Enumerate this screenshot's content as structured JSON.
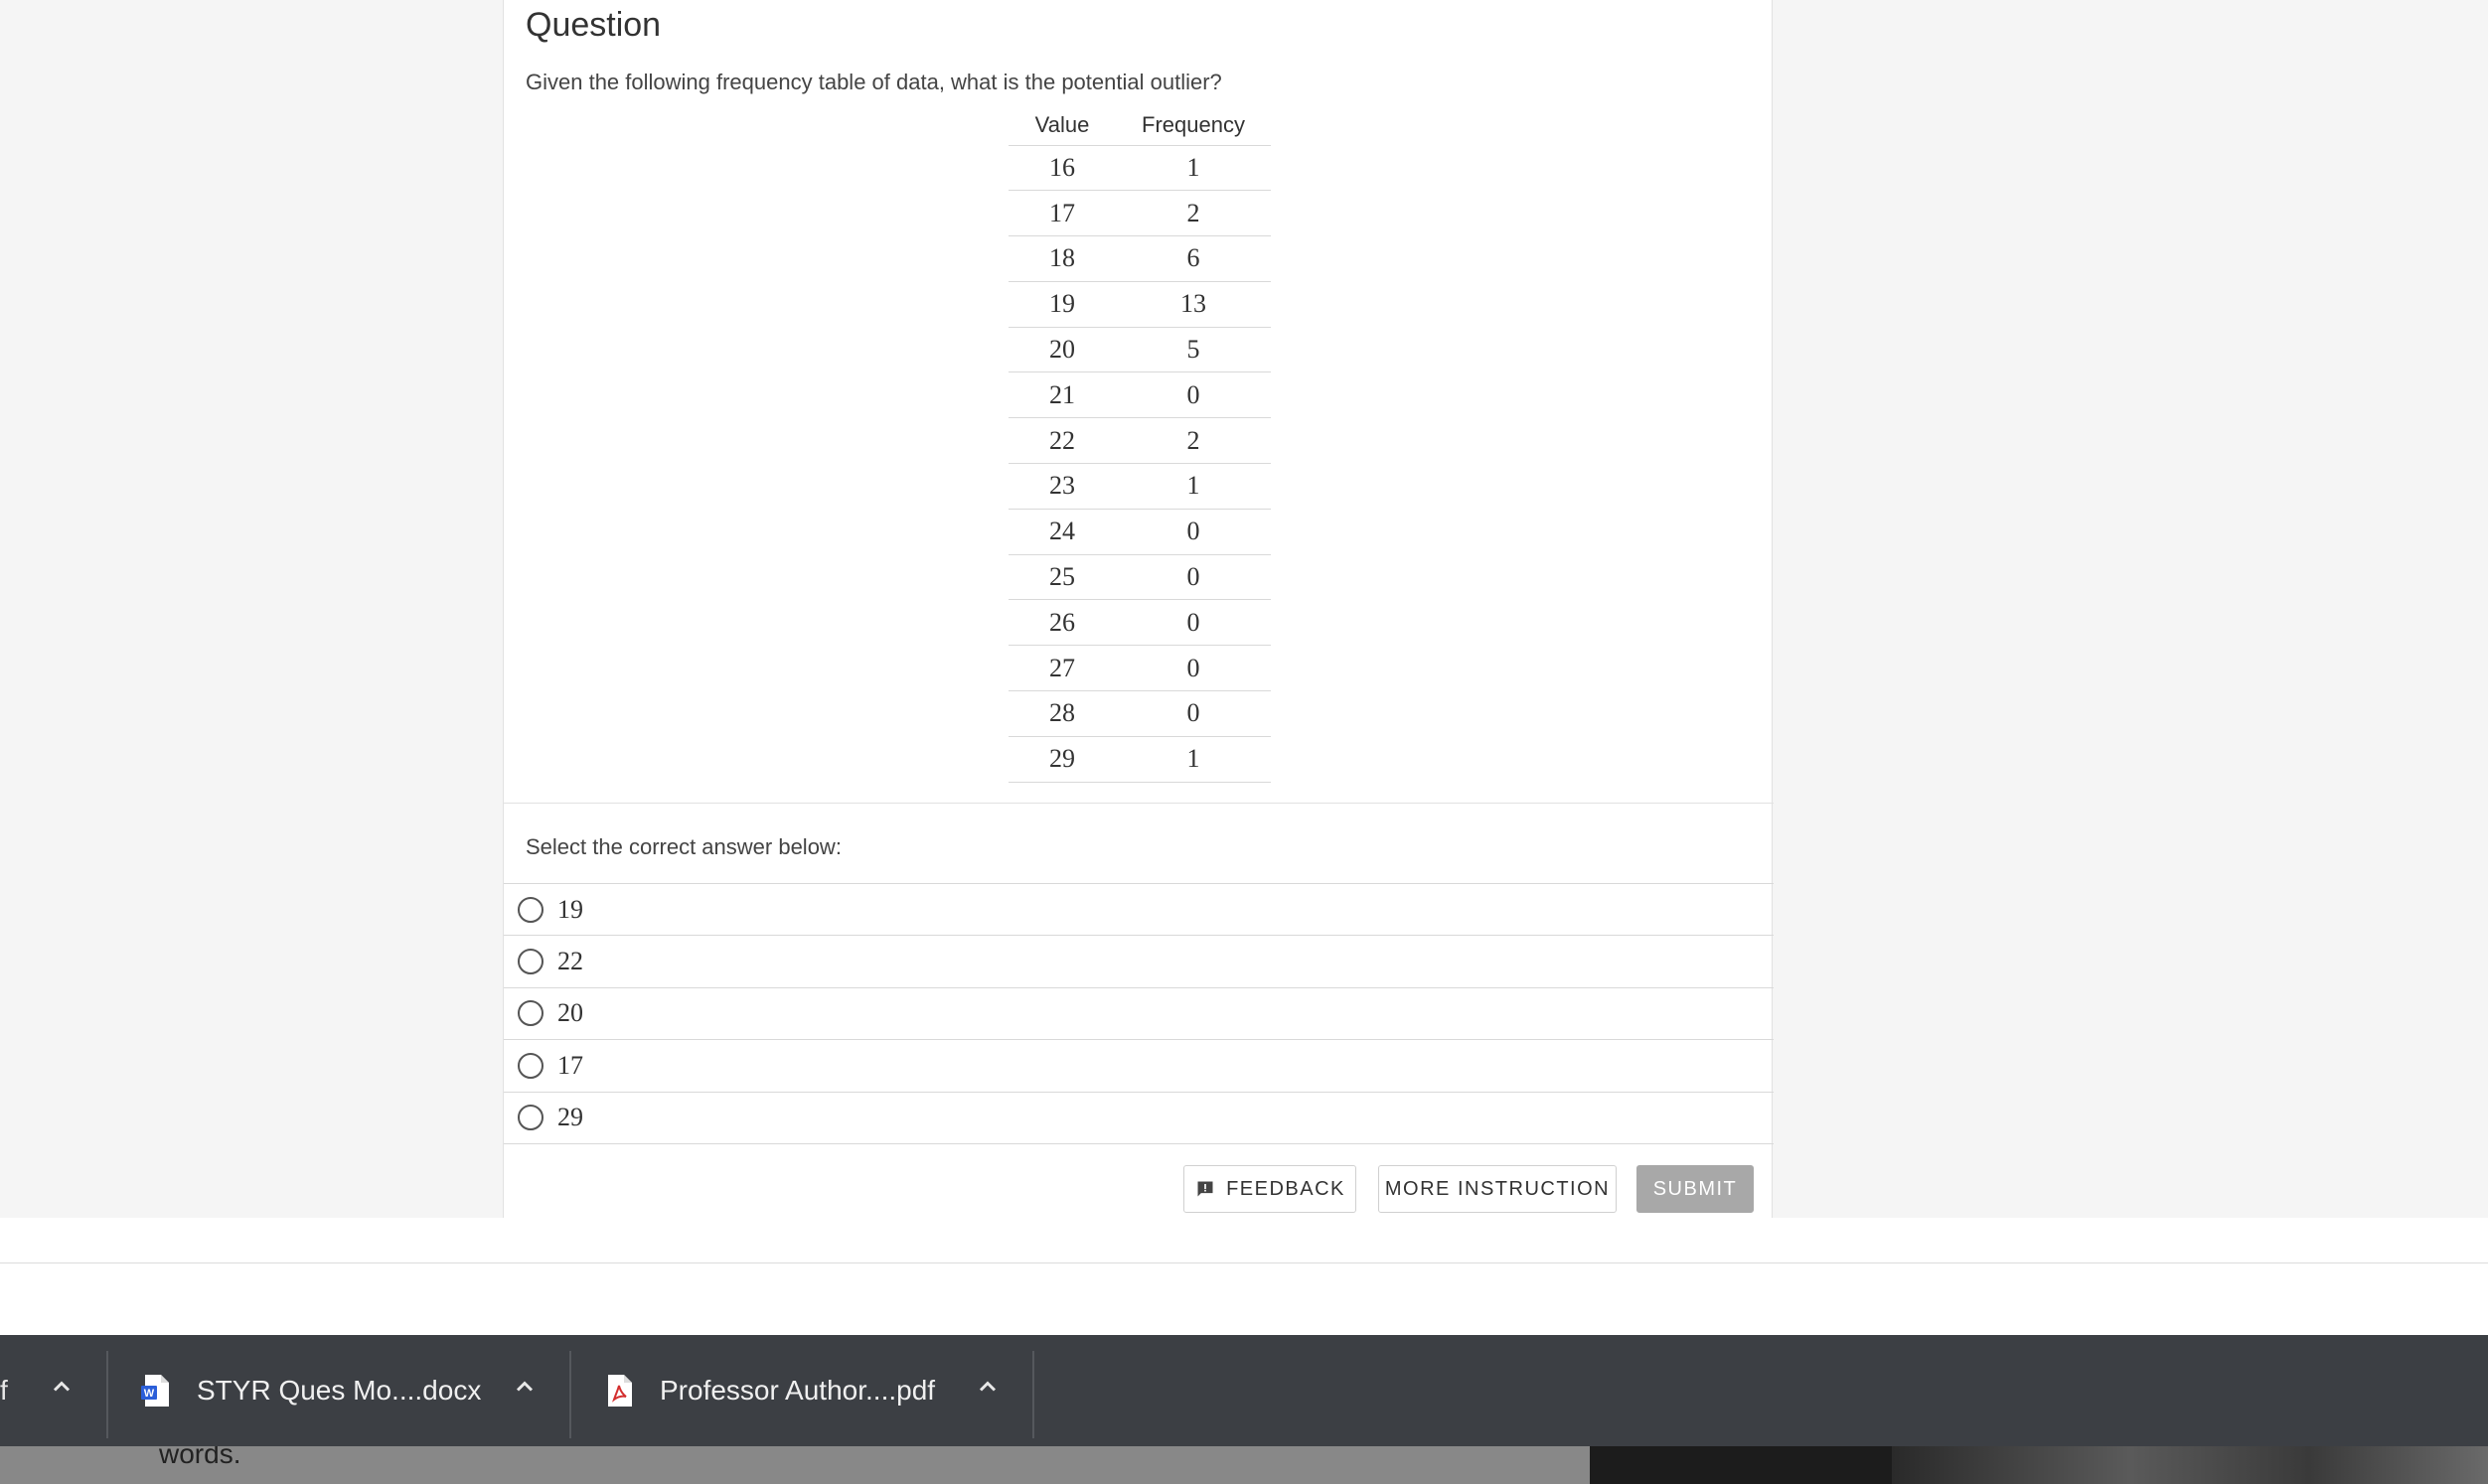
{
  "question": {
    "title": "Question",
    "prompt": "Given the following frequency table of data, what is the potential outlier?",
    "table": {
      "headers": [
        "Value",
        "Frequency"
      ],
      "rows": [
        [
          "16",
          "1"
        ],
        [
          "17",
          "2"
        ],
        [
          "18",
          "6"
        ],
        [
          "19",
          "13"
        ],
        [
          "20",
          "5"
        ],
        [
          "21",
          "0"
        ],
        [
          "22",
          "2"
        ],
        [
          "23",
          "1"
        ],
        [
          "24",
          "0"
        ],
        [
          "25",
          "0"
        ],
        [
          "26",
          "0"
        ],
        [
          "27",
          "0"
        ],
        [
          "28",
          "0"
        ],
        [
          "29",
          "1"
        ]
      ]
    }
  },
  "answers": {
    "label": "Select the correct answer below:",
    "options": [
      "19",
      "22",
      "20",
      "17",
      "29"
    ]
  },
  "buttons": {
    "feedback": "FEEDBACK",
    "more_instruction": "MORE INSTRUCTION",
    "submit": "SUBMIT"
  },
  "downloads": {
    "partial_label": "f",
    "items": [
      {
        "name": "STYR Ques Mo....docx",
        "icon": "word-doc-icon"
      },
      {
        "name": "Professor Author....pdf",
        "icon": "pdf-icon"
      }
    ]
  },
  "background_text": "words."
}
